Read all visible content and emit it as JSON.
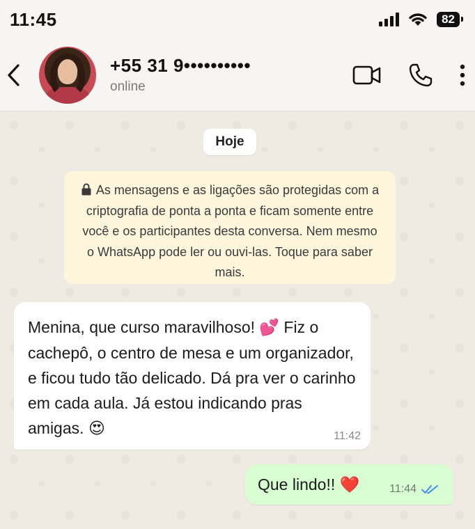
{
  "status_bar": {
    "time": "11:45",
    "battery": "82"
  },
  "header": {
    "contact_name": "+55 31 9••••••••••",
    "contact_status": "online"
  },
  "chat": {
    "date_label": "Hoje",
    "encryption_notice": "As mensagens e as ligações são protegidas com a criptografia de ponta a ponta e ficam somente entre você e os participantes desta conversa. Nem mesmo o WhatsApp pode ler ou ouvi-las. Toque para saber mais.",
    "messages": [
      {
        "direction": "incoming",
        "text_part1": "Menina, que curso maravilhoso! ",
        "emoji1": "💕",
        "text_part2": " Fiz o cachepô, o centro de mesa e um organizador, e ficou tudo tão delicado. Dá pra ver o carinho em cada aula. Já estou indicando pras amigas. ",
        "emoji2": "😍",
        "time": "11:42"
      },
      {
        "direction": "outgoing",
        "text": "Que lindo!! ",
        "emoji": "❤️",
        "time": "11:44",
        "read_receipt_icon": "double-check-icon"
      }
    ]
  },
  "colors": {
    "chat_background": "#efeae2",
    "incoming_bubble": "#ffffff",
    "outgoing_bubble": "#d9fdd3",
    "system_note": "#fdf5dc",
    "read_check": "#3d8ef0"
  }
}
